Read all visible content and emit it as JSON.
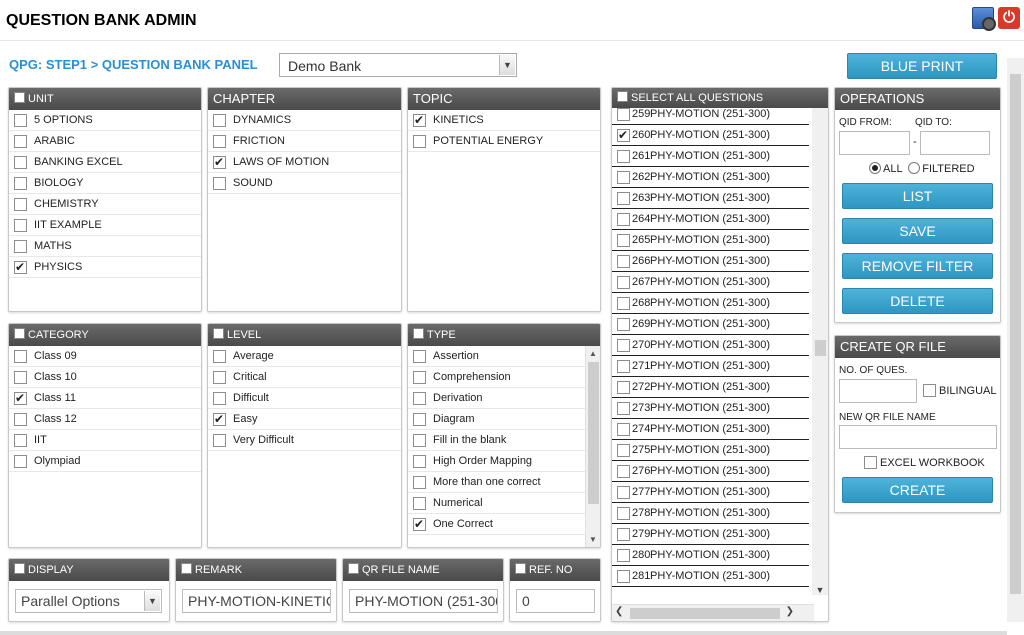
{
  "app": {
    "title": "QUESTION BANK ADMIN",
    "breadcrumb": "QPG: STEP1 > QUESTION BANK PANEL"
  },
  "bank_select": {
    "value": "Demo Bank"
  },
  "toolbar": {
    "blueprint_label": "BLUE PRINT"
  },
  "unit": {
    "title": "UNIT",
    "items": [
      {
        "label": "5 OPTIONS",
        "checked": false
      },
      {
        "label": "ARABIC",
        "checked": false
      },
      {
        "label": "BANKING EXCEL",
        "checked": false
      },
      {
        "label": "BIOLOGY",
        "checked": false
      },
      {
        "label": "CHEMISTRY",
        "checked": false
      },
      {
        "label": "IIT EXAMPLE",
        "checked": false
      },
      {
        "label": "MATHS",
        "checked": false
      },
      {
        "label": "PHYSICS",
        "checked": true
      }
    ]
  },
  "chapter": {
    "title": "CHAPTER",
    "items": [
      {
        "label": "DYNAMICS",
        "checked": false
      },
      {
        "label": "FRICTION",
        "checked": false
      },
      {
        "label": "LAWS OF MOTION",
        "checked": true
      },
      {
        "label": "SOUND",
        "checked": false
      }
    ]
  },
  "topic": {
    "title": "TOPIC",
    "items": [
      {
        "label": "KINETICS",
        "checked": true
      },
      {
        "label": "POTENTIAL ENERGY",
        "checked": false
      }
    ]
  },
  "category": {
    "title": "CATEGORY",
    "items": [
      {
        "label": "Class 09",
        "checked": false
      },
      {
        "label": "Class 10",
        "checked": false
      },
      {
        "label": "Class 11",
        "checked": true
      },
      {
        "label": "Class 12",
        "checked": false
      },
      {
        "label": "IIT",
        "checked": false
      },
      {
        "label": "Olympiad",
        "checked": false
      }
    ]
  },
  "level": {
    "title": "LEVEL",
    "items": [
      {
        "label": "Average",
        "checked": false
      },
      {
        "label": "Critical",
        "checked": false
      },
      {
        "label": "Difficult",
        "checked": false
      },
      {
        "label": "Easy",
        "checked": true
      },
      {
        "label": "Very Difficult",
        "checked": false
      }
    ]
  },
  "type": {
    "title": "TYPE",
    "items": [
      {
        "label": "Assertion",
        "checked": false
      },
      {
        "label": "Comprehension",
        "checked": false
      },
      {
        "label": "Derivation",
        "checked": false
      },
      {
        "label": "Diagram",
        "checked": false
      },
      {
        "label": "Fill in the blank",
        "checked": false
      },
      {
        "label": "High Order Mapping",
        "checked": false
      },
      {
        "label": "More than one correct",
        "checked": false
      },
      {
        "label": "Numerical",
        "checked": false
      },
      {
        "label": "One Correct",
        "checked": true
      }
    ]
  },
  "questions": {
    "title": "SELECT ALL QUESTIONS",
    "items": [
      {
        "id": "259",
        "label": "PHY-MOTION (251-300)",
        "checked": false
      },
      {
        "id": "260",
        "label": "PHY-MOTION (251-300)",
        "checked": true
      },
      {
        "id": "261",
        "label": "PHY-MOTION (251-300)",
        "checked": false
      },
      {
        "id": "262",
        "label": "PHY-MOTION (251-300)",
        "checked": false
      },
      {
        "id": "263",
        "label": "PHY-MOTION (251-300)",
        "checked": false
      },
      {
        "id": "264",
        "label": "PHY-MOTION (251-300)",
        "checked": false
      },
      {
        "id": "265",
        "label": "PHY-MOTION (251-300)",
        "checked": false
      },
      {
        "id": "266",
        "label": "PHY-MOTION (251-300)",
        "checked": false
      },
      {
        "id": "267",
        "label": "PHY-MOTION (251-300)",
        "checked": false
      },
      {
        "id": "268",
        "label": "PHY-MOTION (251-300)",
        "checked": false
      },
      {
        "id": "269",
        "label": "PHY-MOTION (251-300)",
        "checked": false
      },
      {
        "id": "270",
        "label": "PHY-MOTION (251-300)",
        "checked": false
      },
      {
        "id": "271",
        "label": "PHY-MOTION (251-300)",
        "checked": false
      },
      {
        "id": "272",
        "label": "PHY-MOTION (251-300)",
        "checked": false
      },
      {
        "id": "273",
        "label": "PHY-MOTION (251-300)",
        "checked": false
      },
      {
        "id": "274",
        "label": "PHY-MOTION (251-300)",
        "checked": false
      },
      {
        "id": "275",
        "label": "PHY-MOTION (251-300)",
        "checked": false
      },
      {
        "id": "276",
        "label": "PHY-MOTION (251-300)",
        "checked": false
      },
      {
        "id": "277",
        "label": "PHY-MOTION (251-300)",
        "checked": false
      },
      {
        "id": "278",
        "label": "PHY-MOTION (251-300)",
        "checked": false
      },
      {
        "id": "279",
        "label": "PHY-MOTION (251-300)",
        "checked": false
      },
      {
        "id": "280",
        "label": "PHY-MOTION (251-300)",
        "checked": false
      },
      {
        "id": "281",
        "label": "PHY-MOTION (251-300)",
        "checked": false
      }
    ]
  },
  "operations": {
    "title": "OPERATIONS",
    "qid_from_label": "QID FROM:",
    "qid_to_label": "QID TO:",
    "dash": "-",
    "all_label": "ALL",
    "filtered_label": "FILTERED",
    "list_label": "LIST",
    "save_label": "SAVE",
    "remove_filter_label": "REMOVE FILTER",
    "delete_label": "DELETE"
  },
  "create_qr": {
    "title": "CREATE QR FILE",
    "no_of_ques_label": "NO. OF QUES.",
    "bilingual_label": "BILINGUAL",
    "new_file_label": "NEW QR FILE NAME",
    "excel_label": "EXCEL WORKBOOK",
    "create_label": "CREATE"
  },
  "display": {
    "title": "DISPLAY",
    "value": "Parallel Options"
  },
  "remark": {
    "title": "REMARK",
    "value": "PHY-MOTION-KINETIC"
  },
  "qr_file_name": {
    "title": "QR FILE NAME",
    "value": "PHY-MOTION (251-300"
  },
  "ref_no": {
    "title": "REF. NO",
    "value": "0"
  }
}
